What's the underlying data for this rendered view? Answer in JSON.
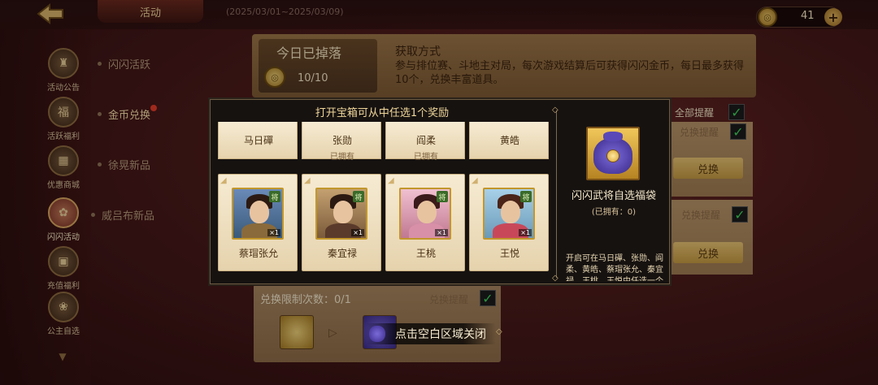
{
  "header": {
    "tab_label": "活动",
    "date_range": "(2025/03/01~2025/03/09)",
    "coin_count": "41"
  },
  "sidebar": {
    "items": [
      {
        "label": "活动公告",
        "icon": "announcement-icon"
      },
      {
        "label": "活跃福利",
        "icon": "welfare-icon"
      },
      {
        "label": "优惠商城",
        "icon": "shop-icon"
      },
      {
        "label": "闪闪活动",
        "icon": "lotus-icon"
      },
      {
        "label": "充值福利",
        "icon": "recharge-gift-icon"
      },
      {
        "label": "公主自选",
        "icon": "princess-icon"
      }
    ],
    "subnav": [
      {
        "label": "闪闪活跃"
      },
      {
        "label": "金币兑换"
      },
      {
        "label": "徐晃新品"
      },
      {
        "label": "威吕布新品"
      }
    ]
  },
  "info_panel": {
    "today_title": "今日已掉落",
    "today_count": "10/10",
    "acquire_title": "获取方式",
    "acquire_desc": "参与排位赛、斗地主对局，每次游戏结算后可获得闪闪金币，每日最多获得10个，兑换丰富道具。"
  },
  "right_column": {
    "all_remind": "全部提醒",
    "remind_label": "兑换提醒",
    "exchange_label": "兑换"
  },
  "bottom_card": {
    "limit_text": "兑换限制次数：0/1",
    "remind_label": "兑换提醒"
  },
  "modal": {
    "title": "打开宝箱可从中任选1个奖励",
    "row1": [
      {
        "name": "马日磾",
        "owned": ""
      },
      {
        "name": "张勋",
        "owned": "已拥有"
      },
      {
        "name": "阎柔",
        "owned": "已拥有"
      },
      {
        "name": "黄皓",
        "owned": ""
      }
    ],
    "row2": [
      {
        "name": "蔡瑁张允",
        "badge": "将",
        "count": "×1"
      },
      {
        "name": "秦宜禄",
        "badge": "将",
        "count": "×1"
      },
      {
        "name": "王桃",
        "badge": "将",
        "count": "×1"
      },
      {
        "name": "王悦",
        "badge": "将",
        "count": "×1"
      }
    ],
    "item_name": "闪闪武将自选福袋",
    "item_owned": "(已拥有：0)",
    "item_desc": "开启可在马日磾、张勋、阎柔、黄皓、蔡瑁张允、秦宜禄、王桃、王悦中任选一个"
  },
  "close_hint": "点击空白区域关闭",
  "colors": {
    "accent_gold": "#f0d79a",
    "check_green": "#3fd15a",
    "red_dot": "#e43b2a"
  }
}
